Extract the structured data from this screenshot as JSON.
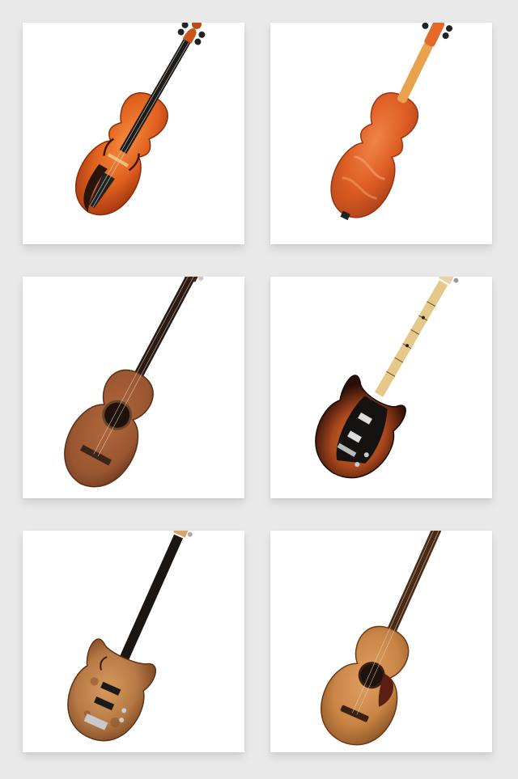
{
  "gallery": {
    "items": [
      {
        "subject": "violin-front",
        "accent": "#d9571b"
      },
      {
        "subject": "violin-back",
        "accent": "#de5e24"
      },
      {
        "subject": "classical-guitar",
        "accent": "#9a5631"
      },
      {
        "subject": "electric-guitar-sunburst",
        "accent": "#a8461c"
      },
      {
        "subject": "bass-guitar-burl",
        "accent": "#b77a45"
      },
      {
        "subject": "acoustic-guitar",
        "accent": "#c98545"
      }
    ]
  },
  "colors": {
    "background": "#e9e9e9",
    "card": "#ffffff"
  }
}
